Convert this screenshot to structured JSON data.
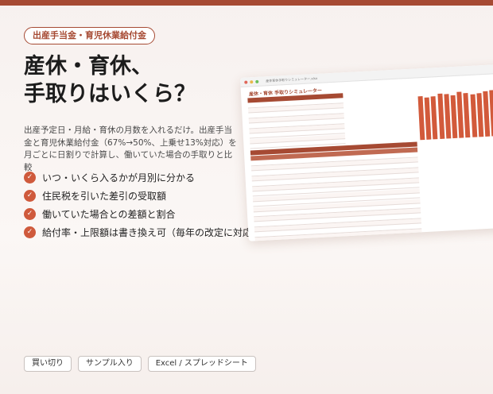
{
  "tag": "出産手当金・育児休業給付金",
  "headline": {
    "line1": "産休・育休、",
    "line2": "手取りはいくら？"
  },
  "description": "出産予定日・月給・育休の月数を入れるだけ。出産手当金と育児休業給付金（67%→50%、上乗せ13%対応）を月ごとに日割りで計算し、働いていた場合の手取りと比較",
  "features": [
    "いつ・いくら入るかが月別に分かる",
    "住民税を引いた差引の受取額",
    "働いていた場合との差額と割合",
    "給付率・上限額は書き換え可（毎年の改定に対応）"
  ],
  "pills": [
    "買い切り",
    "サンプル入り",
    "Excel / スプレッドシート"
  ],
  "sheet": {
    "file_name": "産休育休手取りシミュレーター.xlsx",
    "title": "産休・育休 手取りシミュレーター",
    "chart_bars": [
      0.92,
      0.88,
      0.9,
      0.95,
      0.93,
      0.9,
      0.96,
      0.94,
      0.9,
      0.92,
      0.95,
      0.97
    ]
  },
  "colors": {
    "accent": "#a64a33",
    "check": "#cf5a3c",
    "bar": "#d25a3b"
  }
}
